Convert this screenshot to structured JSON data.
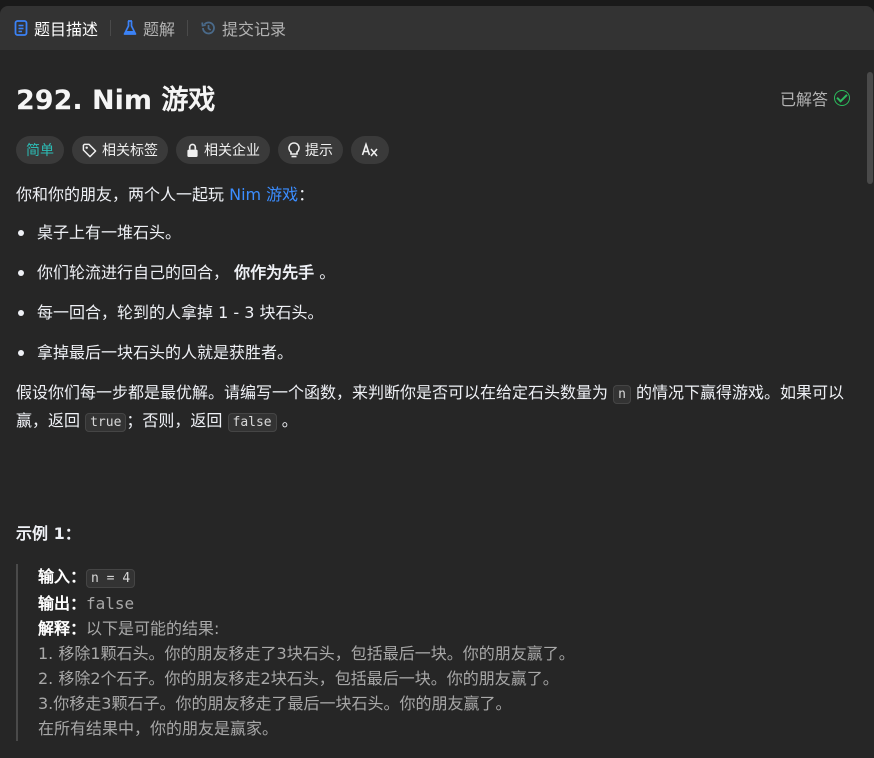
{
  "tabs": [
    {
      "label": "题目描述",
      "icon": "document-icon",
      "active": true
    },
    {
      "label": "题解",
      "icon": "flask-icon",
      "active": false
    },
    {
      "label": "提交记录",
      "icon": "history-icon",
      "active": false
    }
  ],
  "problem": {
    "title": "292. Nim 游戏",
    "status": "已解答"
  },
  "tags": {
    "difficulty": "简单",
    "related_tags": "相关标签",
    "related_companies": "相关企业",
    "hint": "提示",
    "translate": "A文"
  },
  "description": {
    "intro_prefix": "你和你的朋友，两个人一起玩 ",
    "intro_link": "Nim 游戏",
    "intro_suffix": "：",
    "bullets": [
      "桌子上有一堆石头。",
      "你们轮流进行自己的回合，",
      "每一回合，轮到的人拿掉 1 - 3 块石头。",
      "拿掉最后一块石头的人就是获胜者。"
    ],
    "bullet2_bold": "你作为先手",
    "bullet2_end": "。",
    "task_part1": "假设你们每一步都是最优解。请编写一个函数，来判断你是否可以在给定石头数量为 ",
    "task_code_n": "n",
    "task_part2": " 的情况下赢得游戏。如果可以赢，返回 ",
    "task_code_true": "true",
    "task_part3": "；否则，返回 ",
    "task_code_false": "false",
    "task_part4": " 。"
  },
  "example": {
    "title": "示例 1：",
    "input_label": "输入：",
    "input_value": "n = 4",
    "output_label": "输出：",
    "output_value": "false",
    "explain_label": "解释：",
    "explain_intro": "以下是可能的结果:",
    "lines": [
      "1. 移除1颗石头。你的朋友移走了3块石头，包括最后一块。你的朋友赢了。",
      "2. 移除2个石子。你的朋友移走2块石头，包括最后一块。你的朋友赢了。",
      "3.你移走3颗石子。你的朋友移走了最后一块石头。你的朋友赢了。",
      "在所有结果中，你的朋友是赢家。"
    ]
  },
  "colors": {
    "accent_blue": "#3b8dff",
    "easy_teal": "#2cbbb4",
    "solved_green": "#2cbb5d",
    "panel_bg": "#262626"
  }
}
